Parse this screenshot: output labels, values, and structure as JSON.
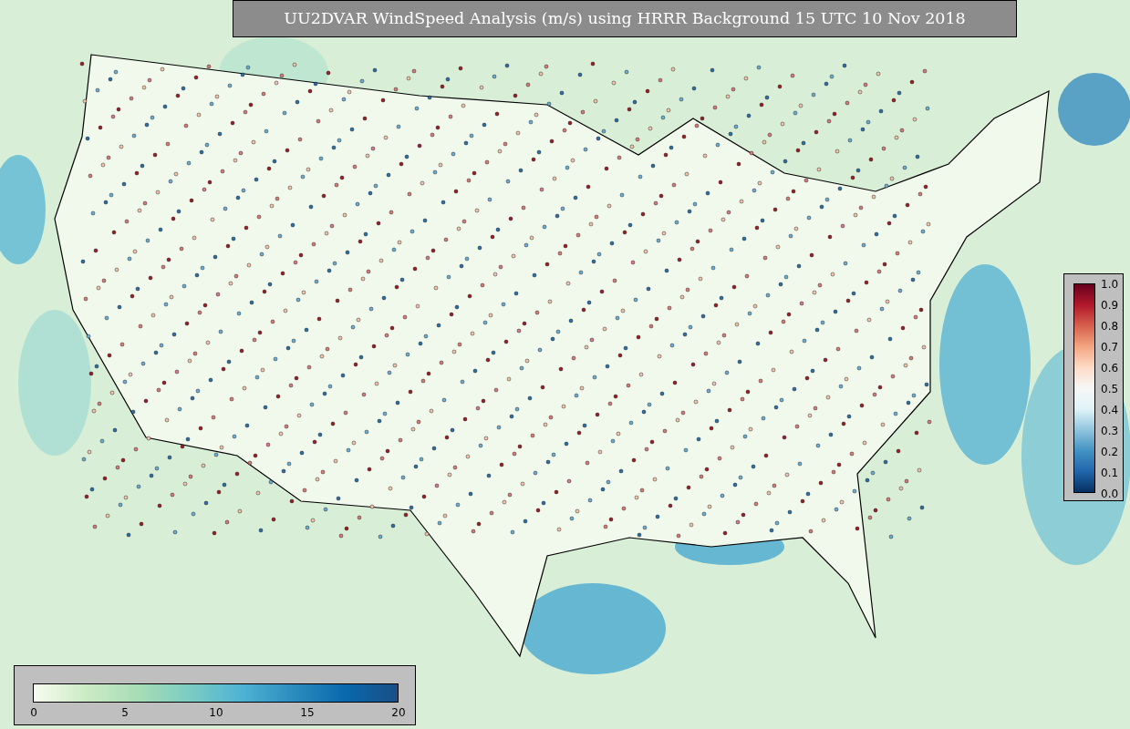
{
  "title": "UU2DVAR WindSpeed Analysis (m/s) using HRRR Background 15 UTC 10 Nov 2018",
  "probability_colorbar": {
    "ticks": [
      "1.0",
      "0.9",
      "0.8",
      "0.7",
      "0.6",
      "0.5",
      "0.4",
      "0.3",
      "0.2",
      "0.1",
      "0.0"
    ]
  },
  "windspeed_colorbar": {
    "ticks": [
      "0",
      "5",
      "10",
      "15",
      "20"
    ]
  }
}
